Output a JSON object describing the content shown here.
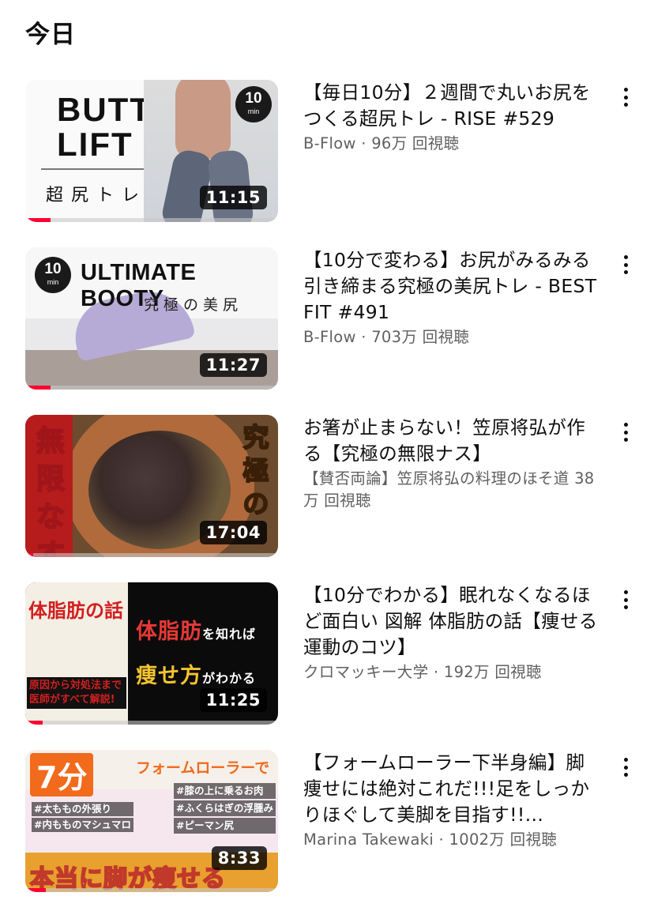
{
  "section": {
    "title": "今日"
  },
  "videos": [
    {
      "title": "【毎日10分】２週間で丸いお尻をつくる超尻トレ - RISE #529",
      "meta": "B-Flow · 96万 回視聴",
      "duration": "11:15",
      "watched_fraction": 0.1,
      "thumb": {
        "line1": "BUTT",
        "line2": "LIFT",
        "jp": "超尻トレ",
        "badge_num": "10",
        "badge_unit": "min"
      }
    },
    {
      "title": "【10分で変わる】お尻がみるみる引き締まる究極の美尻トレ - BEST FIT #491",
      "meta": "B-Flow · 703万 回視聴",
      "duration": "11:27",
      "watched_fraction": 0.1,
      "thumb": {
        "headline": "ULTIMATE BOOTY",
        "jp": "究極の美尻",
        "badge_num": "10",
        "badge_unit": "min"
      }
    },
    {
      "title": "お箸が止まらない！笠原将弘が作る【究極の無限ナス】",
      "meta": "【賛否両論】笠原将弘の料理のほそ道 38万 回視聴",
      "duration": "17:04",
      "watched_fraction": 0.03,
      "thumb": {
        "left": "無限なす",
        "right": "究極の"
      }
    },
    {
      "title": "【10分でわかる】眠れなくなるほど面白い 図解 体脂肪の話【痩せる運動のコツ】",
      "meta": "クロマッキー大学 · 192万 回視聴",
      "duration": "11:25",
      "watched_fraction": 0.07,
      "thumb": {
        "book": "体脂肪の話",
        "footer": "原因から対処法まで医師がすべて解説!",
        "line1": "体脂肪",
        "line1_small": "を知れば",
        "line2": "痩せ方",
        "line2_small": "がわかる"
      }
    },
    {
      "title": "【フォームローラー下半身編】脚痩せには絶対これだ!!!足をしっかりほぐして美脚を目指す!!…",
      "meta": "Marina Takewaki · 1002万 回視聴",
      "duration": "8:33",
      "watched_fraction": 0.08,
      "thumb": {
        "minutes": "7分",
        "headline": "フォームローラーで",
        "tags_left": [
          "#太ももの外張り",
          "#内もものマシュマロ"
        ],
        "tags_right": [
          "#膝の上に乗るお肉",
          "#ふくらはぎの浮腫み",
          "#ピーマン尻"
        ],
        "bottom": "本当に脚が痩せる"
      }
    }
  ],
  "colors": {
    "progress": "#ff0033",
    "meta_text": "#606060",
    "title_text": "#0f0f0f"
  },
  "icons": {
    "menu": "more-vert-icon"
  }
}
